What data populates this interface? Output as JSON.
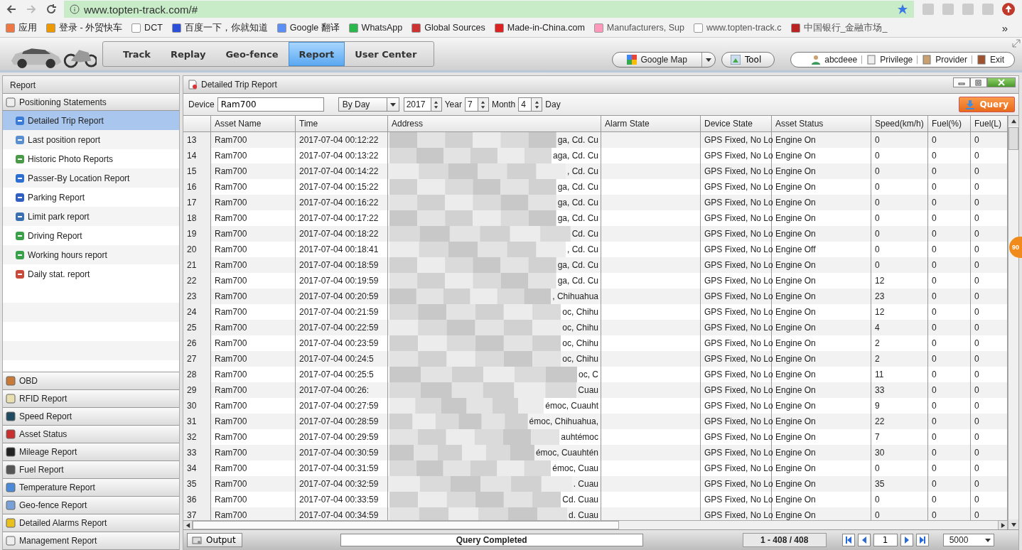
{
  "browser": {
    "url": "www.topten-track.com/#",
    "bookmarks": [
      "应用",
      "登录 - 外贸快车",
      "DCT",
      "百度一下，你就知道",
      "Google 翻译",
      "WhatsApp",
      "Global Sources",
      "Made-in-China.com",
      "Manufacturers, Sup",
      "www.topten-track.c",
      "中国银行_金融市场_"
    ],
    "more": "»"
  },
  "nav": {
    "tabs": [
      {
        "label": "Track",
        "selected": false
      },
      {
        "label": "Replay",
        "selected": false
      },
      {
        "label": "Geo-fence",
        "selected": false
      },
      {
        "label": "Report",
        "selected": true
      },
      {
        "label": "User Center",
        "selected": false
      }
    ]
  },
  "map_select": "Google Map",
  "tool": "Tool",
  "user": {
    "name": "abcdeee",
    "links": [
      "Privilege",
      "Provider",
      "Exit"
    ]
  },
  "sidebar": {
    "title": "Report",
    "groups": [
      {
        "label": "Positioning Statements",
        "items": [
          {
            "label": "Detailed Trip Report",
            "selected": true
          },
          {
            "label": "Last position report",
            "selected": false
          },
          {
            "label": "Historic Photo Reports",
            "selected": false
          },
          {
            "label": "Passer-By Location Report",
            "selected": false
          },
          {
            "label": "Parking Report",
            "selected": false
          },
          {
            "label": "Limit park report",
            "selected": false
          },
          {
            "label": "Driving Report",
            "selected": false
          },
          {
            "label": "Working hours report",
            "selected": false
          },
          {
            "label": "Daily stat. report",
            "selected": false
          }
        ]
      },
      {
        "label": "OBD"
      },
      {
        "label": "RFID Report"
      },
      {
        "label": "Speed Report"
      },
      {
        "label": "Asset Status"
      },
      {
        "label": "Mileage Report"
      },
      {
        "label": "Fuel Report"
      },
      {
        "label": "Temperature Report"
      },
      {
        "label": "Geo-fence Report"
      },
      {
        "label": "Detailed Alarms Report"
      },
      {
        "label": "Management Report"
      }
    ]
  },
  "report": {
    "title": "Detailed Trip Report",
    "device_label": "Device",
    "device": "Ram700",
    "period": "By Day",
    "year": "2017",
    "year_label": "Year",
    "month": "7",
    "month_label": "Month",
    "day": "4",
    "day_label": "Day",
    "query": "Query",
    "columns": [
      "Asset Name",
      "Time",
      "Address",
      "Alarm State",
      "Device State",
      "Asset Status",
      "Speed(km/h)",
      "Fuel(%)",
      "Fuel(L)"
    ],
    "rows": [
      {
        "n": "13",
        "asset": "Ram700",
        "time": "2017-07-04 00:12:22",
        "address": "ga, Cd. Cu",
        "device_state": "GPS Fixed, No Lo",
        "asset_status": "Engine On",
        "speed": "0",
        "fuel_pct": "0",
        "fuel_l": "0"
      },
      {
        "n": "14",
        "asset": "Ram700",
        "time": "2017-07-04 00:13:22",
        "address": "aga, Cd. Cu",
        "device_state": "GPS Fixed, No Lo",
        "asset_status": "Engine On",
        "speed": "0",
        "fuel_pct": "0",
        "fuel_l": "0"
      },
      {
        "n": "15",
        "asset": "Ram700",
        "time": "2017-07-04 00:14:22",
        "address": ", Cd. Cu",
        "device_state": "GPS Fixed, No Lo",
        "asset_status": "Engine On",
        "speed": "0",
        "fuel_pct": "0",
        "fuel_l": "0"
      },
      {
        "n": "16",
        "asset": "Ram700",
        "time": "2017-07-04 00:15:22",
        "address": "ga, Cd. Cu",
        "device_state": "GPS Fixed, No Lo",
        "asset_status": "Engine On",
        "speed": "0",
        "fuel_pct": "0",
        "fuel_l": "0"
      },
      {
        "n": "17",
        "asset": "Ram700",
        "time": "2017-07-04 00:16:22",
        "address": "ga, Cd. Cu",
        "device_state": "GPS Fixed, No Lo",
        "asset_status": "Engine On",
        "speed": "0",
        "fuel_pct": "0",
        "fuel_l": "0"
      },
      {
        "n": "18",
        "asset": "Ram700",
        "time": "2017-07-04 00:17:22",
        "address": "ga, Cd. Cu",
        "device_state": "GPS Fixed, No Lo",
        "asset_status": "Engine On",
        "speed": "0",
        "fuel_pct": "0",
        "fuel_l": "0"
      },
      {
        "n": "19",
        "asset": "Ram700",
        "time": "2017-07-04 00:18:22",
        "address": "Cd. Cu",
        "device_state": "GPS Fixed, No Lo",
        "asset_status": "Engine On",
        "speed": "0",
        "fuel_pct": "0",
        "fuel_l": "0"
      },
      {
        "n": "20",
        "asset": "Ram700",
        "time": "2017-07-04 00:18:41",
        "address": ", Cd. Cu",
        "device_state": "GPS Fixed, No Lo",
        "asset_status": "Engine Off",
        "speed": "0",
        "fuel_pct": "0",
        "fuel_l": "0"
      },
      {
        "n": "21",
        "asset": "Ram700",
        "time": "2017-07-04 00:18:59",
        "address": "ga, Cd. Cu",
        "device_state": "GPS Fixed, No Lo",
        "asset_status": "Engine On",
        "speed": "0",
        "fuel_pct": "0",
        "fuel_l": "0"
      },
      {
        "n": "22",
        "asset": "Ram700",
        "time": "2017-07-04 00:19:59",
        "address": "ga, Cd. Cu",
        "device_state": "GPS Fixed, No Lo",
        "asset_status": "Engine On",
        "speed": "12",
        "fuel_pct": "0",
        "fuel_l": "0"
      },
      {
        "n": "23",
        "asset": "Ram700",
        "time": "2017-07-04 00:20:59",
        "address": ", Chihuahua",
        "device_state": "GPS Fixed, No Lo",
        "asset_status": "Engine On",
        "speed": "23",
        "fuel_pct": "0",
        "fuel_l": "0"
      },
      {
        "n": "24",
        "asset": "Ram700",
        "time": "2017-07-04 00:21:59",
        "address": "oc, Chihu",
        "device_state": "GPS Fixed, No Lo",
        "asset_status": "Engine On",
        "speed": "12",
        "fuel_pct": "0",
        "fuel_l": "0"
      },
      {
        "n": "25",
        "asset": "Ram700",
        "time": "2017-07-04 00:22:59",
        "address": "oc, Chihu",
        "device_state": "GPS Fixed, No Lo",
        "asset_status": "Engine On",
        "speed": "4",
        "fuel_pct": "0",
        "fuel_l": "0"
      },
      {
        "n": "26",
        "asset": "Ram700",
        "time": "2017-07-04 00:23:59",
        "address": "oc, Chihu",
        "device_state": "GPS Fixed, No Lo",
        "asset_status": "Engine On",
        "speed": "2",
        "fuel_pct": "0",
        "fuel_l": "0"
      },
      {
        "n": "27",
        "asset": "Ram700",
        "time": "2017-07-04 00:24:5",
        "address": "oc, Chihu",
        "device_state": "GPS Fixed, No Lo",
        "asset_status": "Engine On",
        "speed": "2",
        "fuel_pct": "0",
        "fuel_l": "0"
      },
      {
        "n": "28",
        "asset": "Ram700",
        "time": "2017-07-04 00:25:5",
        "address": "oc, C",
        "device_state": "GPS Fixed, No Lo",
        "asset_status": "Engine On",
        "speed": "11",
        "fuel_pct": "0",
        "fuel_l": "0"
      },
      {
        "n": "29",
        "asset": "Ram700",
        "time": "2017-07-04 00:26:",
        "address": "Cuau",
        "device_state": "GPS Fixed, No Lo",
        "asset_status": "Engine On",
        "speed": "33",
        "fuel_pct": "0",
        "fuel_l": "0"
      },
      {
        "n": "30",
        "asset": "Ram700",
        "time": "2017-07-04 00:27:59",
        "address": "émoc, Cuauht",
        "device_state": "GPS Fixed, No Lo",
        "asset_status": "Engine On",
        "speed": "9",
        "fuel_pct": "0",
        "fuel_l": "0"
      },
      {
        "n": "31",
        "asset": "Ram700",
        "time": "2017-07-04 00:28:59",
        "address": "émoc, Chihuahua,",
        "device_state": "GPS Fixed, No Lo",
        "asset_status": "Engine On",
        "speed": "22",
        "fuel_pct": "0",
        "fuel_l": "0"
      },
      {
        "n": "32",
        "asset": "Ram700",
        "time": "2017-07-04 00:29:59",
        "address": "auhtémoc",
        "device_state": "GPS Fixed, No Lo",
        "asset_status": "Engine On",
        "speed": "7",
        "fuel_pct": "0",
        "fuel_l": "0"
      },
      {
        "n": "33",
        "asset": "Ram700",
        "time": "2017-07-04 00:30:59",
        "address": "émoc, Cuauhtén",
        "device_state": "GPS Fixed, No Lo",
        "asset_status": "Engine On",
        "speed": "30",
        "fuel_pct": "0",
        "fuel_l": "0"
      },
      {
        "n": "34",
        "asset": "Ram700",
        "time": "2017-07-04 00:31:59",
        "address": "émoc, Cuau",
        "device_state": "GPS Fixed, No Lo",
        "asset_status": "Engine On",
        "speed": "0",
        "fuel_pct": "0",
        "fuel_l": "0"
      },
      {
        "n": "35",
        "asset": "Ram700",
        "time": "2017-07-04 00:32:59",
        "address": ". Cuau",
        "device_state": "GPS Fixed, No Lo",
        "asset_status": "Engine On",
        "speed": "35",
        "fuel_pct": "0",
        "fuel_l": "0"
      },
      {
        "n": "36",
        "asset": "Ram700",
        "time": "2017-07-04 00:33:59",
        "address": "Cd. Cuau",
        "device_state": "GPS Fixed, No Lo",
        "asset_status": "Engine On",
        "speed": "0",
        "fuel_pct": "0",
        "fuel_l": "0"
      },
      {
        "n": "37",
        "asset": "Ram700",
        "time": "2017-07-04 00:34:59",
        "address": "d. Cuau",
        "device_state": "GPS Fixed, No Lo",
        "asset_status": "Engine On",
        "speed": "0",
        "fuel_pct": "0",
        "fuel_l": "0"
      }
    ],
    "output": "Output",
    "status": "Query Completed",
    "range": "1 - 408 / 408",
    "page": "1",
    "page_size": "5000"
  },
  "badge": "90"
}
